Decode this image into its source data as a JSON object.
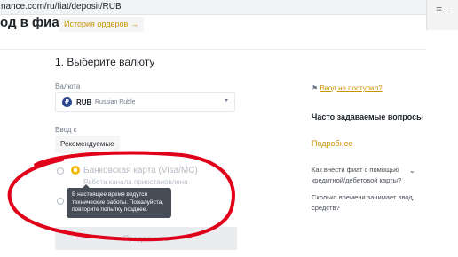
{
  "browser": {
    "url": "nance.com/ru/fiat/deposit/RUB",
    "right_label": "☰ ..."
  },
  "header": {
    "title": "од в фиате",
    "history_button": "История ордеров",
    "history_arrow": "→"
  },
  "form": {
    "step_title": "1. Выберите валюту",
    "currency_label": "Валюта",
    "currency": {
      "icon_text": "₽",
      "code": "RUB",
      "name": "Russian Ruble"
    },
    "input_label": "Ввод с",
    "recommended_tab": "Рекомендуемые",
    "methods": [
      {
        "title": "Банковская карта (Visa/MC)",
        "subtitle": "Работа канала приостановлена"
      }
    ],
    "tooltip": {
      "line1": "В настоящее время ведутся",
      "line2": "технические работы. Пожалуйста,",
      "line3": "повторите попытку позднее."
    },
    "continue_button": "Продолжить"
  },
  "sidebar": {
    "not_received_icon": "⚑",
    "not_received": "Ввод не поступил?",
    "faq_title": "Часто задаваемые вопросы",
    "more_link": "Подробнее",
    "faq": [
      {
        "question": "Как внести фиат с помощью кредитной/дебетовой карты?"
      },
      {
        "question": "Сколько времени занимает ввод средств?"
      }
    ],
    "caret": "⌄"
  },
  "colors": {
    "accent": "#c99400",
    "annotation": "#e0001a",
    "tooltip_bg": "#474d57",
    "disabled_text": "#b7bdc6"
  }
}
